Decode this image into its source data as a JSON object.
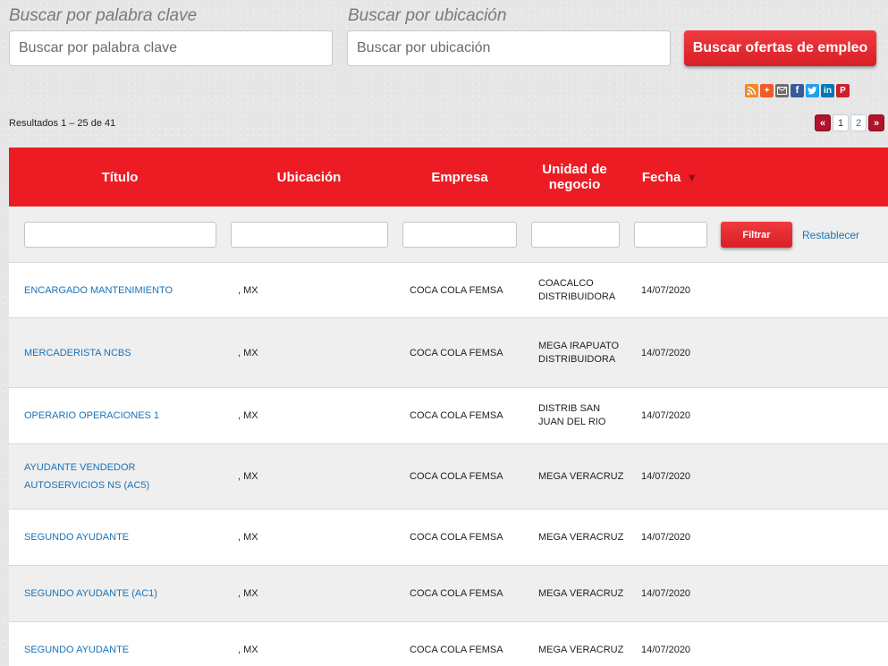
{
  "search": {
    "keyword_label": "Buscar por palabra clave",
    "keyword_placeholder": "Buscar por palabra clave",
    "location_label": "Buscar por ubicación",
    "location_placeholder": "Buscar por ubicación",
    "button_label": "Buscar ofertas de empleo"
  },
  "share_icons": [
    "rss-icon",
    "plus-icon",
    "email-icon",
    "facebook-icon",
    "twitter-icon",
    "linkedin-icon",
    "pinterest-icon"
  ],
  "results_text": "Resultados 1 – 25 de 41",
  "pagination": {
    "prev": "«",
    "pages": [
      "1",
      "2"
    ],
    "current": "1",
    "next": "»"
  },
  "table": {
    "headers": {
      "title": "Título",
      "location": "Ubicación",
      "company": "Empresa",
      "unit": "Unidad de negocio",
      "date": "Fecha"
    },
    "sort_indicator": "▼",
    "filter_button": "Filtrar",
    "reset_link": "Restablecer",
    "rows": [
      {
        "title": "ENCARGADO MANTENIMIENTO",
        "location": ", MX",
        "company": "COCA COLA FEMSA",
        "unit": "COACALCO DISTRIBUIDORA",
        "date": "14/07/2020"
      },
      {
        "title": "MERCADERISTA NCBS",
        "location": ", MX",
        "company": "COCA COLA FEMSA",
        "unit": "MEGA IRAPUATO DISTRIBUIDORA",
        "date": "14/07/2020"
      },
      {
        "title": "OPERARIO OPERACIONES 1",
        "location": ", MX",
        "company": "COCA COLA FEMSA",
        "unit": "DISTRIB SAN JUAN DEL RIO",
        "date": "14/07/2020"
      },
      {
        "title": "AYUDANTE VENDEDOR AUTOSERVICIOS NS (AC5)",
        "location": ", MX",
        "company": "COCA COLA FEMSA",
        "unit": "MEGA VERACRUZ",
        "date": "14/07/2020"
      },
      {
        "title": "SEGUNDO AYUDANTE",
        "location": ", MX",
        "company": "COCA COLA FEMSA",
        "unit": "MEGA VERACRUZ",
        "date": "14/07/2020"
      },
      {
        "title": "SEGUNDO AYUDANTE (AC1)",
        "location": ", MX",
        "company": "COCA COLA FEMSA",
        "unit": "MEGA VERACRUZ",
        "date": "14/07/2020"
      },
      {
        "title": "SEGUNDO AYUDANTE",
        "location": ", MX",
        "company": "COCA COLA FEMSA",
        "unit": "MEGA VERACRUZ",
        "date": "14/07/2020"
      }
    ]
  },
  "colors": {
    "brand_red": "#ed1c24",
    "link_blue": "#1a73b8",
    "pager_red": "#b0132a"
  }
}
